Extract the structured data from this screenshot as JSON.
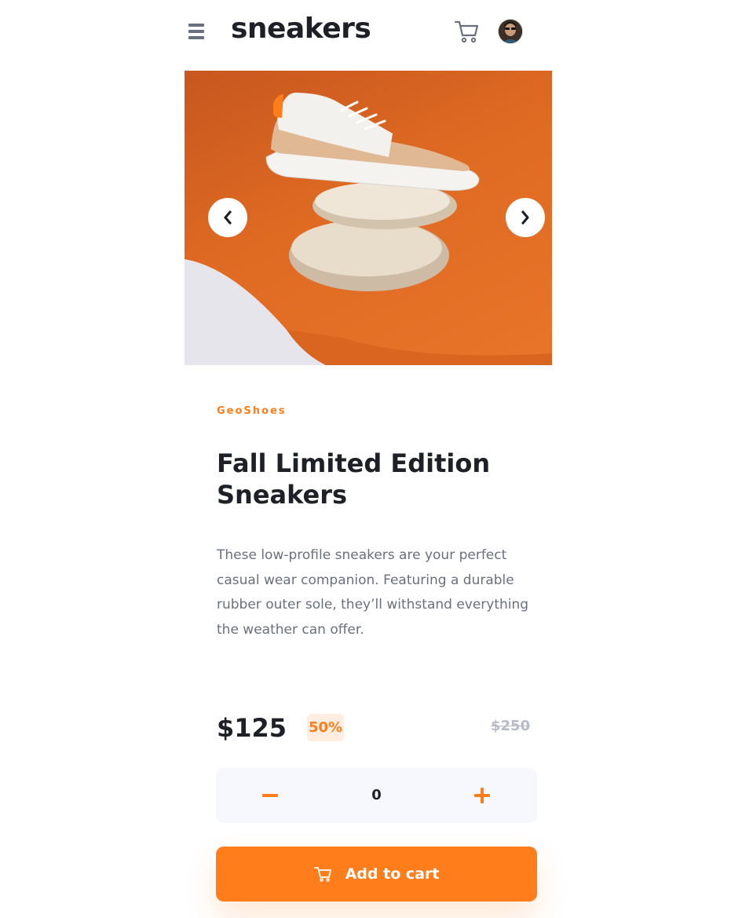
{
  "header": {
    "logo": "sneakers",
    "menu_icon": "hamburger-menu-icon",
    "cart_icon": "cart-icon",
    "avatar_icon": "user-avatar"
  },
  "gallery": {
    "prev_icon": "chevron-left-icon",
    "next_icon": "chevron-right-icon"
  },
  "product": {
    "brand": "GeoShoes",
    "title": "Fall Limited Edition Sneakers",
    "description": "These low-profile sneakers are your perfect casual wear companion. Featuring a durable rubber outer sole, they’ll withstand everything the weather can offer.",
    "price": "$125",
    "discount": "50%",
    "original_price": "$250"
  },
  "quantity": {
    "value": "0",
    "minus_icon": "minus-icon",
    "plus_icon": "plus-icon"
  },
  "add_to_cart": {
    "label": "Add to cart",
    "icon": "cart-icon"
  },
  "colors": {
    "accent": "#ff7e1b",
    "accent_pale": "#ffede0",
    "text_dark": "#1d2026",
    "text_gray": "#69707d",
    "text_light": "#b6bcc8",
    "qty_bg": "#f6f8fd"
  }
}
